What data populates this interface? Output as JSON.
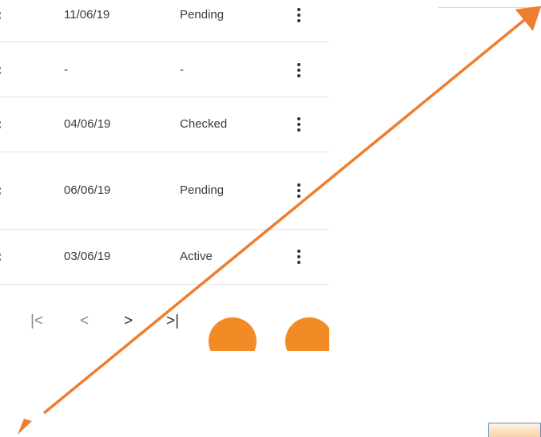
{
  "table": {
    "rows": [
      {
        "date": "11/06/19",
        "status": "Pending"
      },
      {
        "date": "-",
        "status": "-"
      },
      {
        "date": "04/06/19",
        "status": "Checked"
      },
      {
        "date": "06/06/19",
        "status": "Pending"
      },
      {
        "date": "03/06/19",
        "status": "Active"
      }
    ]
  },
  "pagination": {
    "first": "|<",
    "prev": "<",
    "next": ">",
    "last": ">|"
  },
  "colors": {
    "annotation_arrow": "#ef7d2f",
    "fab": "#f28b26"
  },
  "icons": [
    "more-vert-icon",
    "first-page-icon",
    "prev-page-icon",
    "next-page-icon",
    "last-page-icon"
  ]
}
